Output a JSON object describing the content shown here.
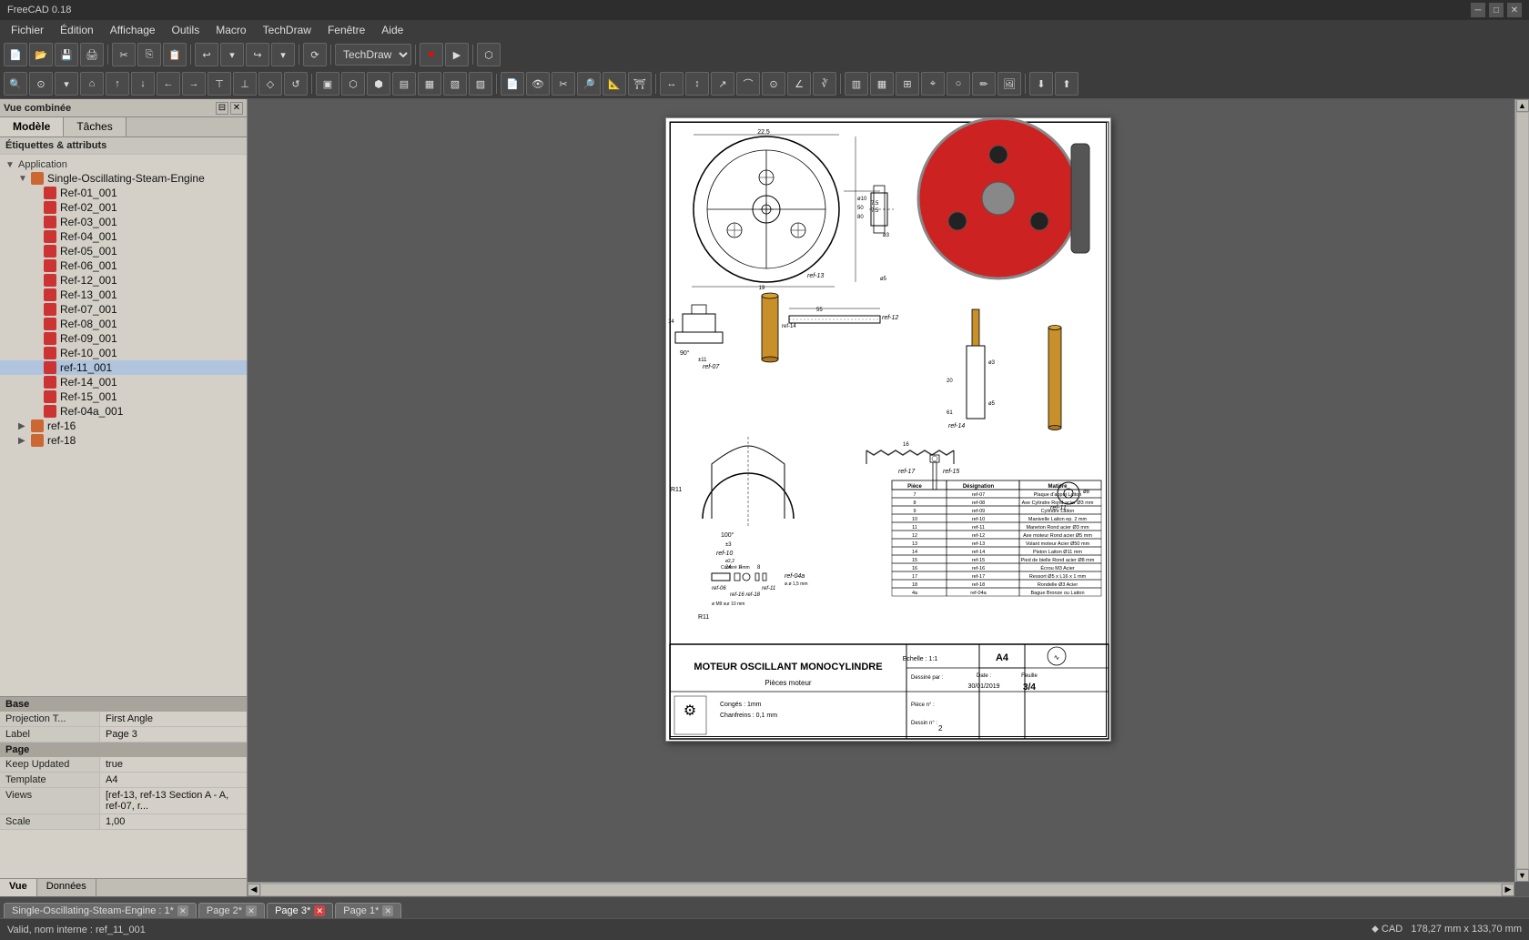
{
  "titlebar": {
    "title": "FreeCAD 0.18",
    "minimize": "─",
    "maximize": "□",
    "close": "✕"
  },
  "menubar": {
    "items": [
      "Fichier",
      "Édition",
      "Affichage",
      "Outils",
      "Macro",
      "TechDraw",
      "Fenêtre",
      "Aide"
    ]
  },
  "toolbar": {
    "workbench": "TechDraw"
  },
  "left_panel": {
    "title": "Vue combinée",
    "tabs": [
      "Modèle",
      "Tâches"
    ],
    "active_tab": "Modèle",
    "section_label": "Étiquettes & attributs",
    "app_label": "Application",
    "tree_root": "Single-Oscillating-Steam-Engine",
    "tree_items": [
      "Ref-01_001",
      "Ref-02_001",
      "Ref-03_001",
      "Ref-04_001",
      "Ref-05_001",
      "Ref-06_001",
      "Ref-12_001",
      "Ref-13_001",
      "Ref-07_001",
      "Ref-08_001",
      "Ref-09_001",
      "Ref-10_001",
      "ref-11_001",
      "Ref-14_001",
      "Ref-15_001",
      "Ref-04a_001",
      "ref-16",
      "ref-18"
    ],
    "bottom_tabs": [
      "Vue",
      "Données"
    ],
    "active_bottom_tab": "Vue"
  },
  "properties": {
    "section_base": "Base",
    "props": [
      {
        "key": "Projection T...",
        "val": "First Angle"
      },
      {
        "key": "Label",
        "val": "Page 3"
      }
    ],
    "section_page": "Page",
    "page_props": [
      {
        "key": "Keep Updated",
        "val": "true"
      },
      {
        "key": "Template",
        "val": "A4"
      },
      {
        "key": "Views",
        "val": "[ref-13, ref-13 Section A - A, ref-07, r..."
      },
      {
        "key": "Scale",
        "val": "1,00"
      }
    ]
  },
  "page_tabs": [
    {
      "label": "Single-Oscillating-Steam-Engine : 1*",
      "active": false
    },
    {
      "label": "Page 2*",
      "active": false
    },
    {
      "label": "Page 3*",
      "active": true
    },
    {
      "label": "Page 1*",
      "active": false
    }
  ],
  "statusbar": {
    "left": "Valid, nom interne : ref_11_001",
    "right_1": "CAD",
    "right_2": "178,27 mm x 133,70 mm"
  },
  "drawing": {
    "title_main": "MOTEUR OSCILLANT MONOCYLINDRE",
    "title_sub": "Pièces moteur",
    "notes": [
      "Congés : 1mm",
      "Chanfreins : 0,1 mm"
    ],
    "echelle": "Echelle : 1:1",
    "format": "A4",
    "dessinateur": "Dessiné par :",
    "date_label": "Date :",
    "date_val": "30/01/2019",
    "feuille_label": "Feuille",
    "feuille_val": "3/4",
    "piece_label": "Pièce n° :",
    "dessin_label": "Dessin n° :",
    "dessin_val": "2",
    "parts_list": {
      "headers": [
        "Pièce",
        "Désignation",
        "Matière"
      ],
      "rows": [
        [
          "7",
          "ref-07",
          "Plaque d'appui",
          "Laiton"
        ],
        [
          "8",
          "ref-08",
          "Axe Cylindre",
          "Rond acier Ø3 mm"
        ],
        [
          "9",
          "ref-09",
          "Cylindre",
          "Laiton"
        ],
        [
          "10",
          "ref-10",
          "Manivelle",
          "Laiton ep. 2 mm"
        ],
        [
          "11",
          "ref-11",
          "Maneton",
          "Rond acier Ø3 mm"
        ],
        [
          "12",
          "ref-12",
          "Axe moteur",
          "Rond acier Ø5 mm"
        ],
        [
          "13",
          "ref-13",
          "Volant moteur",
          "Acier Ø50 mm"
        ],
        [
          "14",
          "ref-14",
          "Piston",
          "Laiton Ø11 mm"
        ],
        [
          "15",
          "ref-15",
          "Pied de bielle",
          "Rond acier Ø8 mm"
        ],
        [
          "16",
          "ref-16",
          "Écrou M3",
          "Acier"
        ],
        [
          "17",
          "ref-17",
          "Ressort",
          "Ø5 x L16 x 1 mm"
        ],
        [
          "18",
          "ref-18",
          "Rondelle Ø3",
          "Acier"
        ],
        [
          "4a",
          "ref-04a",
          "Bague",
          "Bronze ou Laiton"
        ]
      ]
    }
  },
  "icons": {
    "expand": "▶",
    "collapse": "▼",
    "folder": "📁",
    "gear": "⚙",
    "close": "✕",
    "minimize": "─",
    "maximize": "□",
    "arrow_left": "◀",
    "arrow_right": "▶",
    "arrow_up": "▲",
    "arrow_down": "▼"
  }
}
